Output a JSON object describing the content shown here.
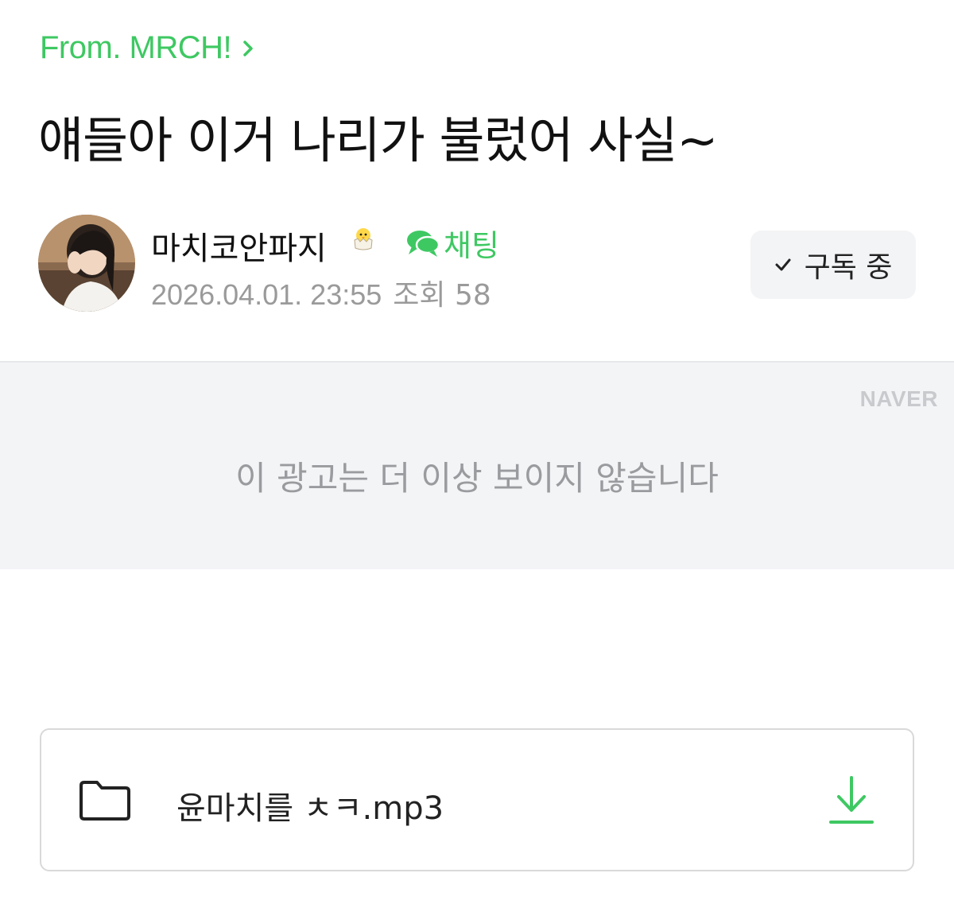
{
  "breadcrumb": {
    "from_label": "From. MRCH!"
  },
  "post": {
    "title": "얘들아 이거 나리가 불렀어 사실~"
  },
  "author": {
    "name": "마치코안파지",
    "badge_icon": "hatching-chick-icon",
    "chat_label": "채팅",
    "date": "2026.04.01. 23:55",
    "views": "조회 58"
  },
  "subscribe": {
    "label": "구독 중",
    "icon": "check-icon"
  },
  "ad": {
    "brand": "NAVER",
    "message": "이 광고는 더 이상 보이지 않습니다"
  },
  "attachment": {
    "file_name": "윤마치를 ㅊㅋ.mp3",
    "icon": "folder-icon",
    "action_icon": "download-icon"
  },
  "colors": {
    "accent_green": "#3ec862",
    "meta_gray": "#9a9a9a",
    "ad_background": "#f3f4f6"
  }
}
